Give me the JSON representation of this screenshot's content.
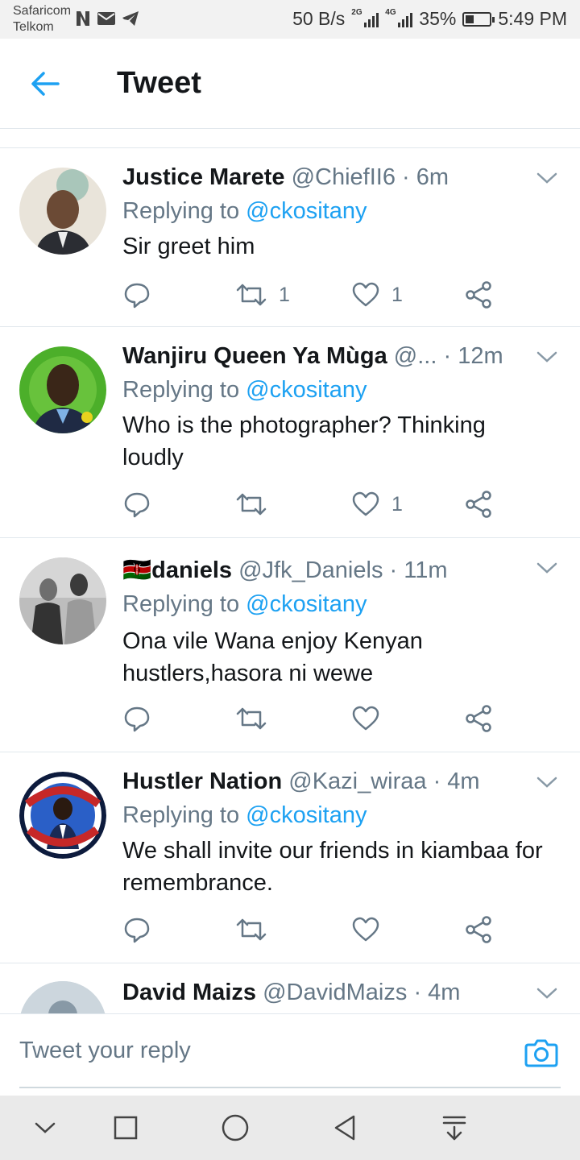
{
  "status_bar": {
    "carrier_1": "Safaricom",
    "carrier_2": "Telkom",
    "left_icons": [
      "netflix-n-icon",
      "mail-icon",
      "telegram-icon"
    ],
    "speed": "50 B/s",
    "sig1_tag": "2G",
    "sig2_tag": "4G",
    "battery_level": 0.35,
    "battery": "35%",
    "time": "5:49 PM"
  },
  "header": {
    "title": "Tweet"
  },
  "tweets": [
    {
      "name": "Justice Marete",
      "handle": "@ChiefII6",
      "time": "· 6m",
      "replying_prefix": "Replying to ",
      "replying_to": "@ckositany",
      "text": "Sir greet him",
      "retweets": "1",
      "likes": "1",
      "avatar_color": "#c9c2b5"
    },
    {
      "name": "Wanjiru Queen Ya Mùga",
      "handle": "@...",
      "time": "· 12m",
      "replying_prefix": "Replying to ",
      "replying_to": "@ckositany",
      "text": "Who is the photographer? Thinking loudly",
      "retweets": "",
      "likes": "1",
      "avatar_color": "#4caf2a"
    },
    {
      "name": "🇰🇪daniels",
      "handle": "@Jfk_Daniels",
      "time": "· 11m",
      "replying_prefix": "Replying to ",
      "replying_to": "@ckositany",
      "text": "Ona vile Wana enjoy Kenyan hustlers,hasora ni wewe",
      "retweets": "",
      "likes": "",
      "avatar_color": "#8a8a8a"
    },
    {
      "name": "Hustler Nation",
      "handle": "@Kazi_wiraa",
      "time": "· 4m",
      "replying_prefix": "Replying to ",
      "replying_to": "@ckositany",
      "text": "We shall invite our friends in kiambaa for remembrance.",
      "retweets": "",
      "likes": "",
      "avatar_color": "#1a3f8f",
      "avatar_text": "I'VE GOT YOUR BACK"
    },
    {
      "name": "David Maizs",
      "handle": "@DavidMaizs",
      "time": "· 4m",
      "avatar_color": "#ccd6dd"
    }
  ],
  "reply_box": {
    "placeholder": "Tweet your reply"
  },
  "colors": {
    "accent": "#1da1f2",
    "muted": "#657786",
    "text": "#14171a",
    "divider": "#e1e8ed"
  }
}
